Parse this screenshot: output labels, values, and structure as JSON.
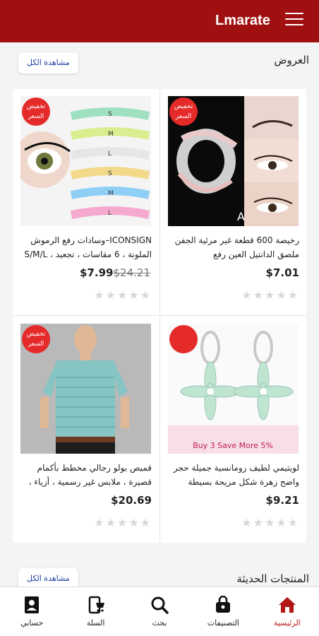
{
  "header": {
    "brand": "Lmarate"
  },
  "offers": {
    "title": "العروض",
    "view_all": "مشاهدة الكل",
    "products": [
      {
        "title": "رخيصة 600 قطعة غير مرئية الجفن ملصق الدانتيل العين رفع",
        "price": "$7.01",
        "old_price": "",
        "badge": "تخفيض السعر",
        "rating": 0,
        "image": "eyelid-tape",
        "image_letter": "A"
      },
      {
        "title": "ICONSIGN–وسادات رفع الرموش الملونة ، 6 مقاسات ، تجعيد ، S/M/L",
        "price": "$7.99",
        "old_price": "$24.21",
        "badge": "تخفيض السعر",
        "rating": 0,
        "image": "lash-pads",
        "size_labels": [
          "S",
          "M",
          "L",
          "S",
          "M",
          "L"
        ]
      },
      {
        "title": "لويتيمي لطيف رومانسية جميلة حجر واضح زهرة شكل مريحة بسيطة",
        "price": "$9.21",
        "old_price": "",
        "badge": "",
        "rating": 0,
        "image": "flower-earrings",
        "promo": "Buy 3 Save More 5%"
      },
      {
        "title": "قميص بولو رجالي مخطط بأكمام قصيرة ، ملابس غير رسمية ، أزياء ،",
        "price": "$20.69",
        "old_price": "",
        "badge": "تخفيض السعر",
        "rating": 0,
        "image": "polo-shirt"
      }
    ]
  },
  "new_products": {
    "title": "المنتجات الحديثة",
    "view_all": "مشاهدة الكل"
  },
  "nav": [
    {
      "label": "الرئيسية",
      "icon": "home-icon",
      "active": true
    },
    {
      "label": "التصنيفات",
      "icon": "bag-icon",
      "active": false
    },
    {
      "label": "بحث",
      "icon": "search-icon",
      "active": false
    },
    {
      "label": "السلة",
      "icon": "cart-icon",
      "active": false
    },
    {
      "label": "حسابي",
      "icon": "account-icon",
      "active": false
    }
  ],
  "colors": {
    "primary": "#a01010",
    "badge": "#e52a2a",
    "link": "#1a3fa0",
    "star": "#d8d8d8"
  }
}
